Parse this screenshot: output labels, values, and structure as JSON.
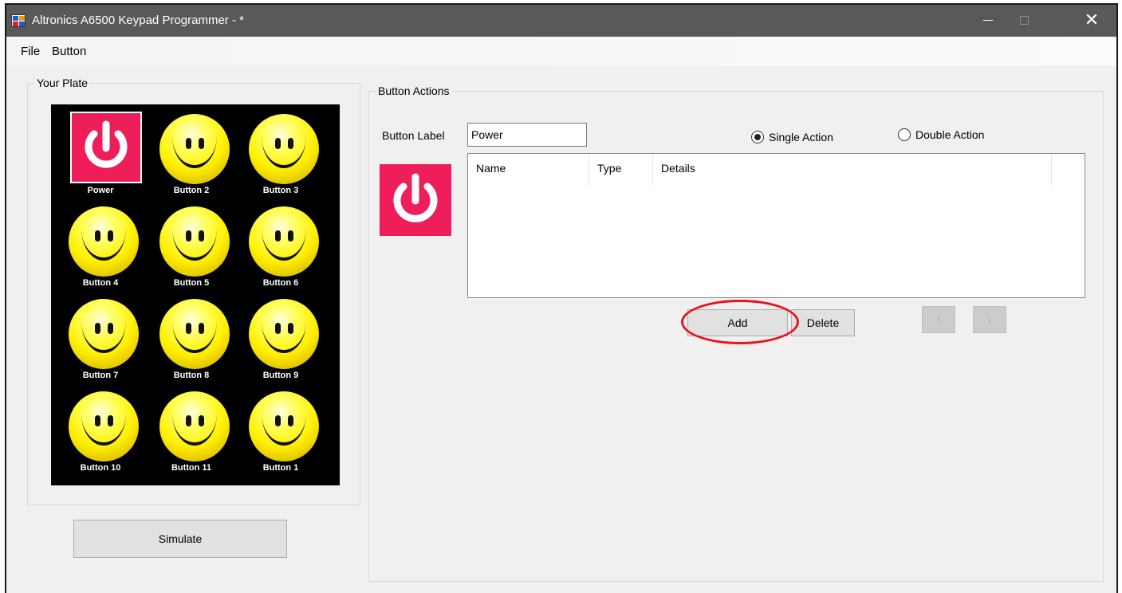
{
  "window": {
    "title": "Altronics A6500 Keypad Programmer - *",
    "controls": {
      "minimize": "minimize-icon",
      "maximize": "maximize-icon",
      "close": "close-icon"
    }
  },
  "menu": {
    "items": [
      "File",
      "Button"
    ]
  },
  "plate": {
    "group_label": "Your Plate",
    "buttons": [
      {
        "label": "Power",
        "icon": "power-icon"
      },
      {
        "label": "Button 2",
        "icon": "smiley-icon"
      },
      {
        "label": "Button 3",
        "icon": "smiley-icon"
      },
      {
        "label": "Button 4",
        "icon": "smiley-icon"
      },
      {
        "label": "Button 5",
        "icon": "smiley-icon"
      },
      {
        "label": "Button 6",
        "icon": "smiley-icon"
      },
      {
        "label": "Button 7",
        "icon": "smiley-icon"
      },
      {
        "label": "Button 8",
        "icon": "smiley-icon"
      },
      {
        "label": "Button 9",
        "icon": "smiley-icon"
      },
      {
        "label": "Button 10",
        "icon": "smiley-icon"
      },
      {
        "label": "Button 11",
        "icon": "smiley-icon"
      },
      {
        "label": "Button 1",
        "icon": "smiley-icon"
      }
    ],
    "simulate_label": "Simulate"
  },
  "actions": {
    "group_label": "Button Actions",
    "button_label_caption": "Button Label",
    "button_label_value": "Power",
    "mode_options": {
      "single": "Single Action",
      "double": "Double Action"
    },
    "selected_mode": "single",
    "list_columns": [
      "Name",
      "Type",
      "Details"
    ],
    "list_rows": [],
    "add_label": "Add",
    "delete_label": "Delete",
    "up_label": "↑",
    "down_label": "↓"
  },
  "colors": {
    "power_tile": "#ee1e5a",
    "highlight": "#e8141e",
    "titlebar": "#595959"
  }
}
